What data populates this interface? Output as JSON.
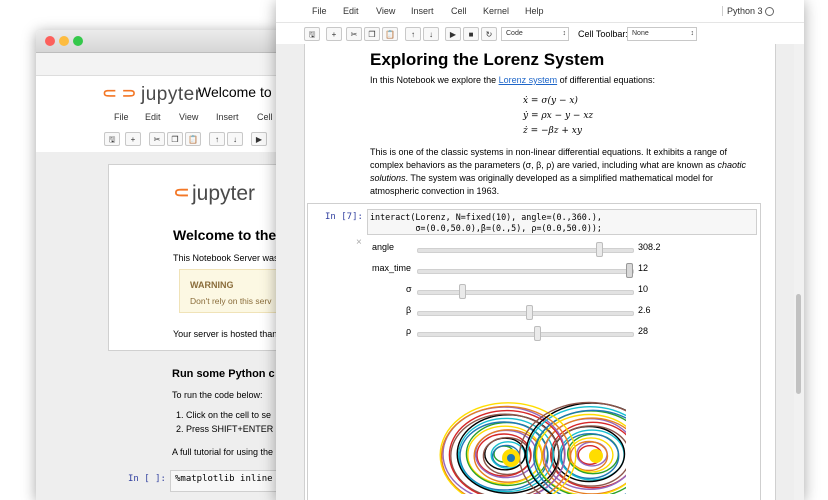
{
  "back": {
    "logo_text": "jupyter",
    "notebook_title": "Welcome to P",
    "menu": [
      "File",
      "Edit",
      "View",
      "Insert",
      "Cell"
    ],
    "page_logo_text": "jupyter",
    "heading": "Welcome to the",
    "intro": "This Notebook Server was",
    "warning_title": "WARNING",
    "warning_text": "Don't rely on this serv",
    "hosted": "Your server is hosted than",
    "run_heading": "Run some Python c",
    "run_intro": "To run the code below:",
    "steps": [
      "1.  Click on the cell to se",
      "2.  Press SHIFT+ENTER"
    ],
    "tutorial": "A full tutorial for using the",
    "prompt": "In [ ]:",
    "code": "%matplotlib inline"
  },
  "front": {
    "menu": [
      "File",
      "Edit",
      "View",
      "Insert",
      "Cell",
      "Kernel",
      "Help"
    ],
    "kernel": "Python 3",
    "cell_type": "Code",
    "cell_toolbar_label": "Cell Toolbar:",
    "cell_toolbar_value": "None",
    "heading": "Exploring the Lorenz System",
    "intro_before": "In this Notebook we explore the ",
    "intro_link": "Lorenz system",
    "intro_after": " of differential equations:",
    "equations": [
      "ẋ = σ(y − x)",
      "ẏ = ρx − y − xz",
      "ż = −βz + xy"
    ],
    "para1_a": "This is one of the classic systems in non-linear differential equations. It exhibits a range of",
    "para1_b": "complex behaviors as the parameters (σ, β, ρ) are varied, including what are known as ",
    "para1_b_em": "chaotic",
    "para1_c_em": "solutions",
    "para1_c": ". The system was originally developed as a simplified mathematical model for",
    "para1_d": "atmospheric convection in 1963.",
    "prompt": "In [7]:",
    "code_line1": "interact(Lorenz, N=fixed(10), angle=(0.,360.),",
    "code_line2": "         σ=(0.0,50.0),β=(0.,5), ρ=(0.0,50.0));",
    "close_glyph": "×",
    "sliders": [
      {
        "label": "angle",
        "value": "308.2",
        "fraction": 0.857
      },
      {
        "label": "max_time",
        "value": "12",
        "fraction": 1.0
      },
      {
        "label": "σ",
        "value": "10",
        "fraction": 0.2
      },
      {
        "label": "β",
        "value": "2.6",
        "fraction": 0.52
      },
      {
        "label": "ρ",
        "value": "28",
        "fraction": 0.56
      }
    ]
  },
  "colors": {
    "accent": "#f37726",
    "link": "#1e66c9",
    "prompt": "#303f9f",
    "attractor": [
      "#2ca02c",
      "#d62728",
      "#1f77b4",
      "#9467bd",
      "#17becf",
      "#e67e22",
      "#000000",
      "#ffdd00",
      "#8c564b"
    ]
  }
}
